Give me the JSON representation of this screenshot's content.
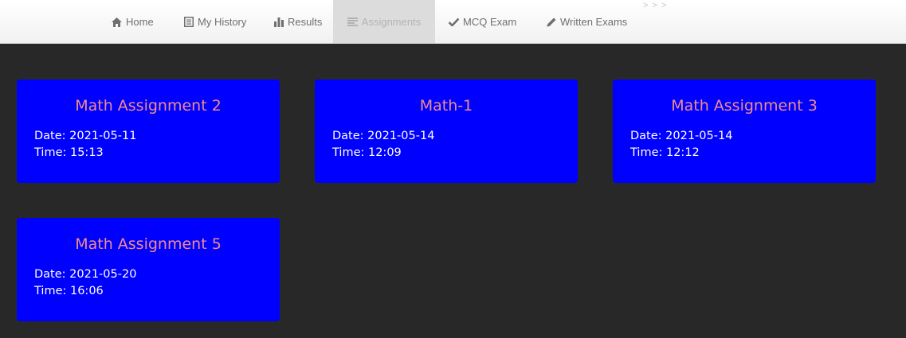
{
  "nav": {
    "items": [
      {
        "label": "Home",
        "icon": "home-icon"
      },
      {
        "label": "My History",
        "icon": "history-icon"
      },
      {
        "label": "Results",
        "icon": "bar-chart-icon"
      },
      {
        "label": "Assignments",
        "icon": "list-icon",
        "active": true
      },
      {
        "label": "MCQ Exam",
        "icon": "check-icon"
      },
      {
        "label": "Written Exams",
        "icon": "pencil-icon"
      }
    ],
    "more": "> > >"
  },
  "assignments": [
    {
      "title": "Math Assignment 2",
      "date": "Date: 2021-05-11",
      "time": "Time: 15:13"
    },
    {
      "title": "Math-1",
      "date": "Date: 2021-05-14",
      "time": "Time: 12:09"
    },
    {
      "title": "Math Assignment 3",
      "date": "Date: 2021-05-14",
      "time": "Time: 12:12"
    },
    {
      "title": "Math Assignment 5",
      "date": "Date: 2021-05-20",
      "time": "Time: 16:06"
    }
  ],
  "colors": {
    "card_bg": "#0000ff",
    "card_title": "#f08c8c",
    "page_bg": "#282828"
  }
}
